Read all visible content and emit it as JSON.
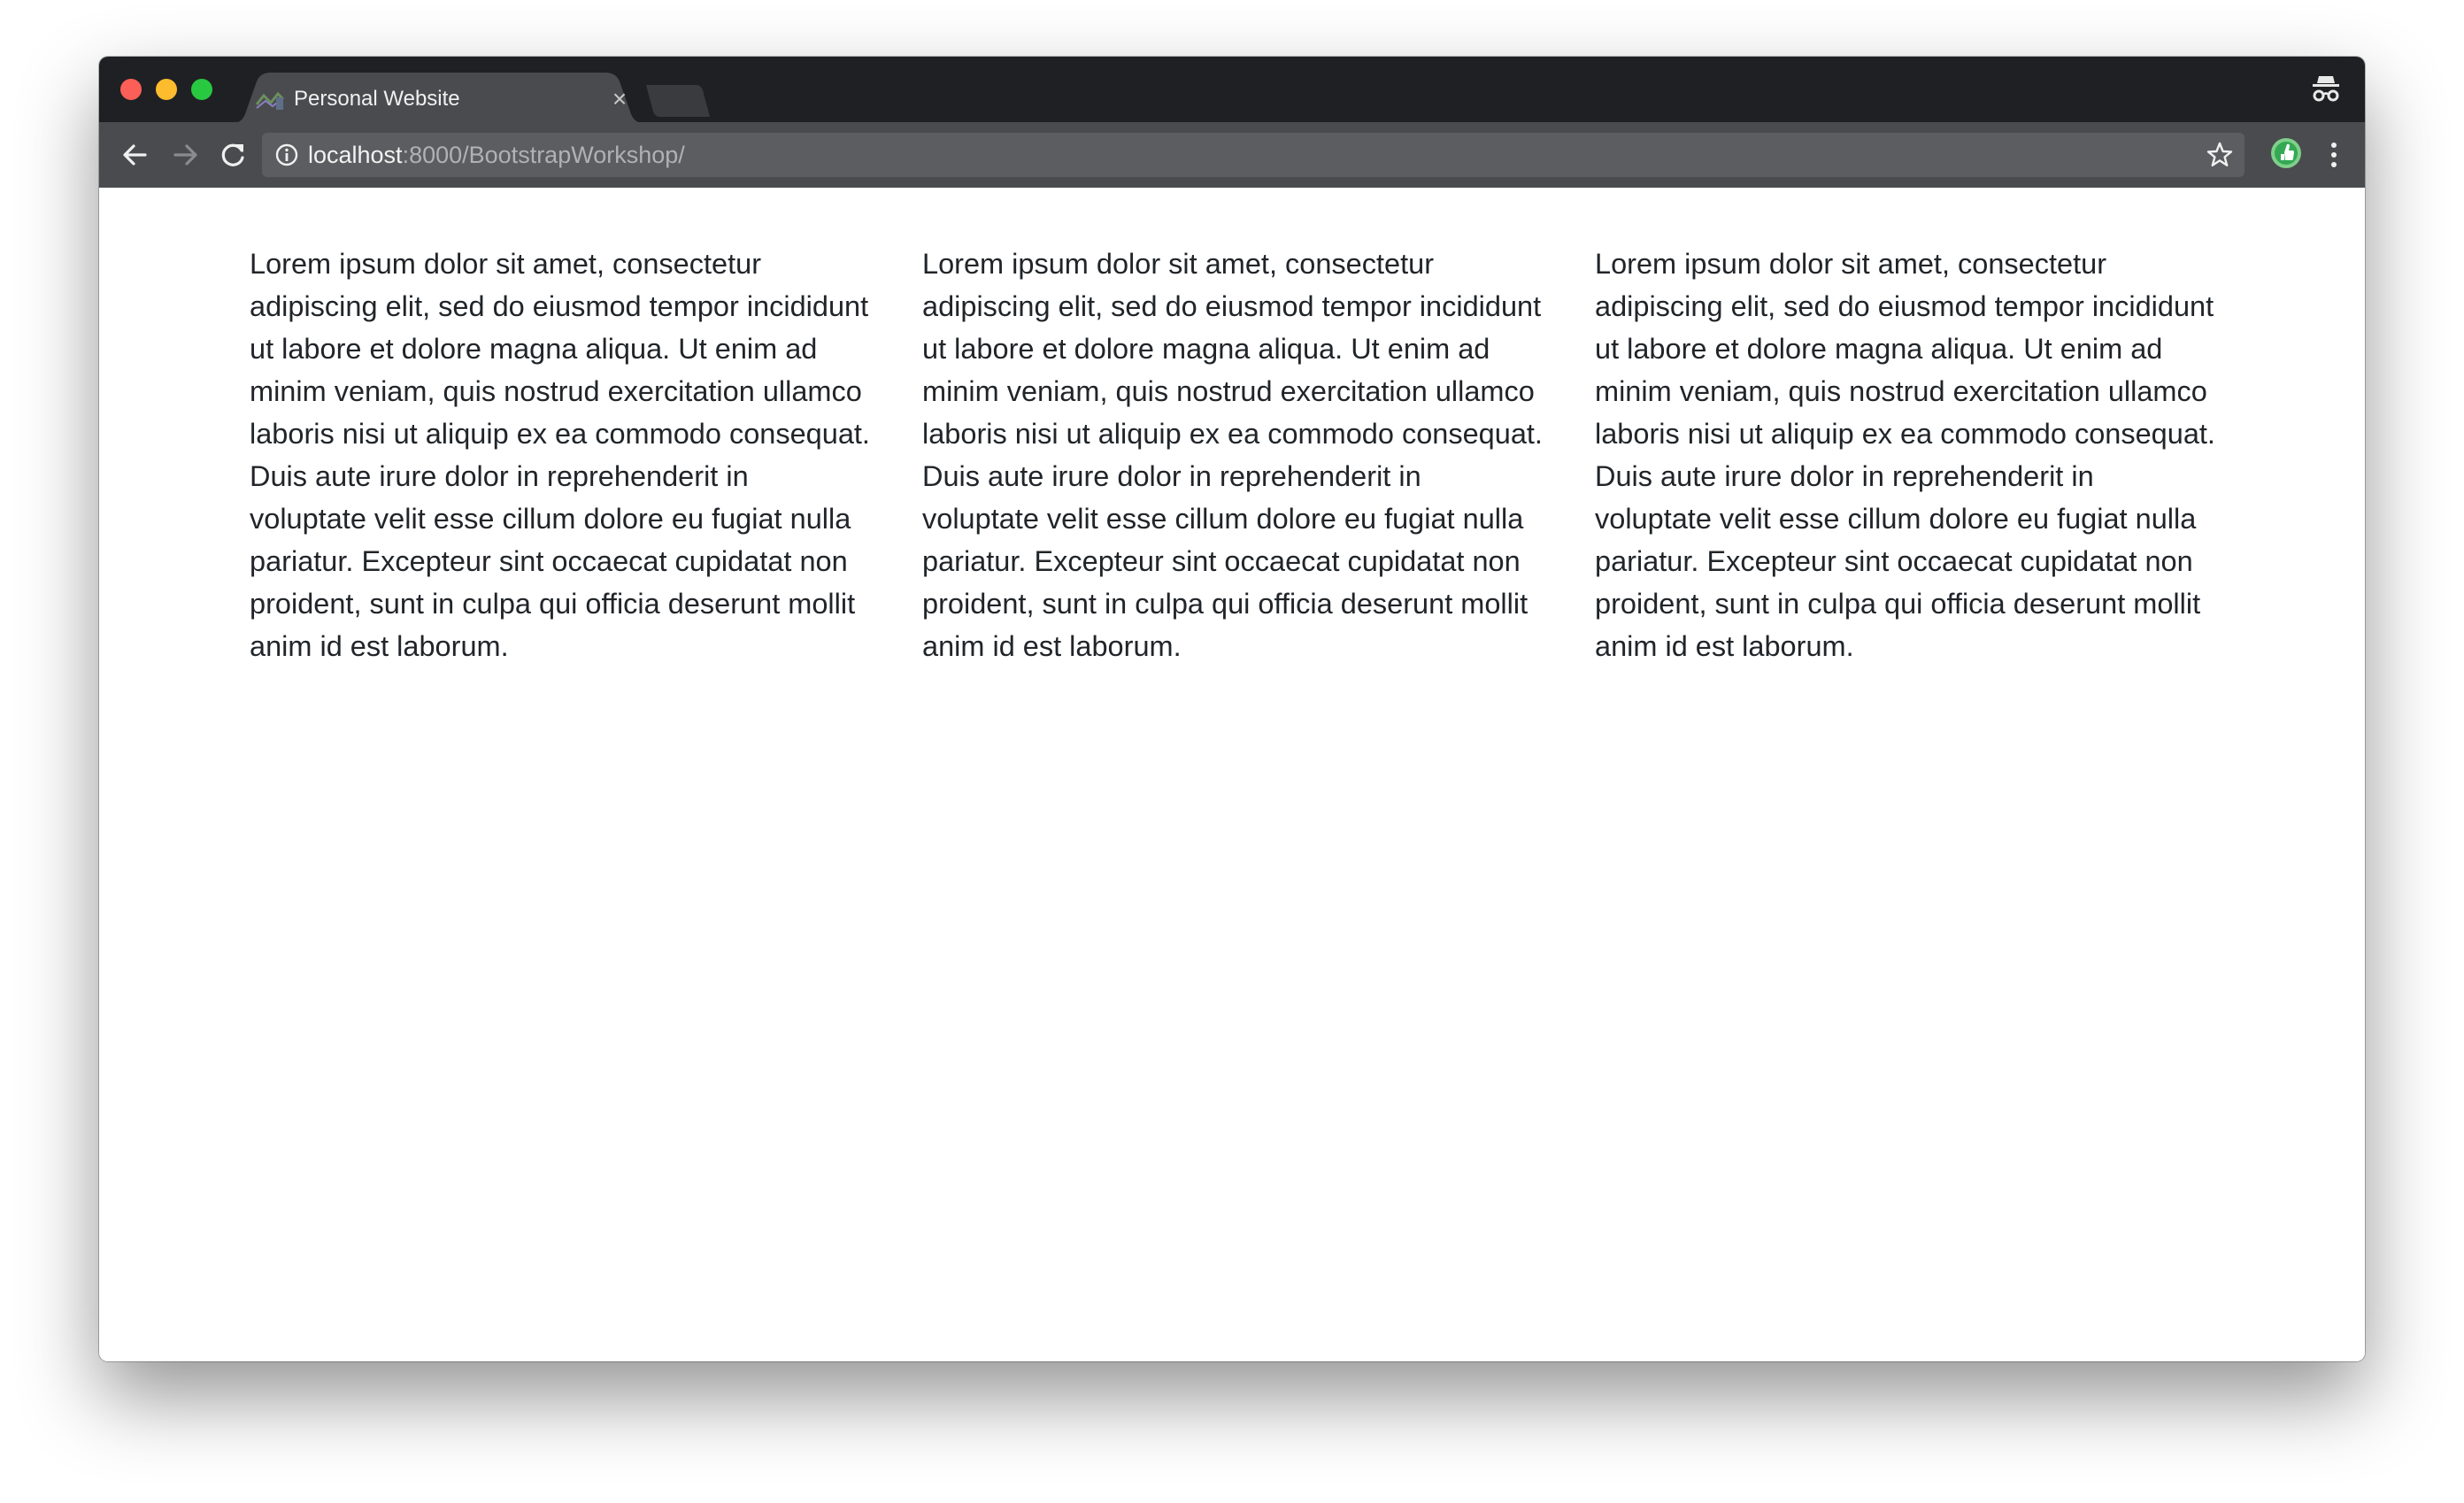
{
  "browser": {
    "tab": {
      "title": "Personal Website",
      "close_glyph": "×"
    },
    "address_bar": {
      "host": "localhost",
      "rest": ":8000/BootstrapWorkshop/"
    },
    "icons": {
      "back": "back-arrow-icon",
      "forward": "forward-arrow-icon",
      "reload": "reload-icon",
      "info": "info-icon",
      "bookmark": "star-icon",
      "extension": "green-extension-icon",
      "menu": "kebab-menu-icon",
      "incognito": "incognito-icon"
    },
    "colors": {
      "tabstrip": "#1f2023",
      "toolbar": "#4a4b4e",
      "omnibox": "#5c5d60",
      "close_dot": "#fc5f57",
      "minimize_dot": "#fdbc2e",
      "maximize_dot": "#28c840",
      "extension_green": "#34a853"
    }
  },
  "page": {
    "columns": [
      {
        "text": "Lorem ipsum dolor sit amet, consectetur adipiscing elit, sed do eiusmod tempor incididunt ut labore et dolore magna aliqua. Ut enim ad minim veniam, quis nostrud exercitation ullamco laboris nisi ut aliquip ex ea commodo consequat. Duis aute irure dolor in reprehenderit in voluptate velit esse cillum dolore eu fugiat nulla pariatur. Excepteur sint occaecat cupidatat non proident, sunt in culpa qui officia deserunt mollit anim id est laborum."
      },
      {
        "text": "Lorem ipsum dolor sit amet, consectetur adipiscing elit, sed do eiusmod tempor incididunt ut labore et dolore magna aliqua. Ut enim ad minim veniam, quis nostrud exercitation ullamco laboris nisi ut aliquip ex ea commodo consequat. Duis aute irure dolor in reprehenderit in voluptate velit esse cillum dolore eu fugiat nulla pariatur. Excepteur sint occaecat cupidatat non proident, sunt in culpa qui officia deserunt mollit anim id est laborum."
      },
      {
        "text": "Lorem ipsum dolor sit amet, consectetur adipiscing elit, sed do eiusmod tempor incididunt ut labore et dolore magna aliqua. Ut enim ad minim veniam, quis nostrud exercitation ullamco laboris nisi ut aliquip ex ea commodo consequat. Duis aute irure dolor in reprehenderit in voluptate velit esse cillum dolore eu fugiat nulla pariatur. Excepteur sint occaecat cupidatat non proident, sunt in culpa qui officia deserunt mollit anim id est laborum."
      }
    ]
  }
}
